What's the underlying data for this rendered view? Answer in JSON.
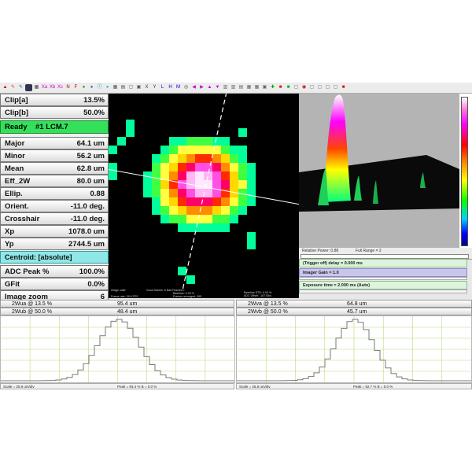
{
  "toolbar": {
    "color_letters": [
      "Xa",
      "Xb",
      "Xc"
    ],
    "letters": [
      "N",
      "F"
    ],
    "axis_letters": [
      "X",
      "Y",
      "L",
      "H",
      "M"
    ]
  },
  "measurements": [
    {
      "label": "Clip[a]",
      "value": "13.5%"
    },
    {
      "label": "Clip[b]",
      "value": "50.0%"
    },
    {
      "label": "Ready",
      "value": "#1 LCM.7"
    },
    {
      "label": "Major",
      "value": "64.1 um"
    },
    {
      "label": "Minor",
      "value": "56.2 um"
    },
    {
      "label": "Mean",
      "value": "62.8 um"
    },
    {
      "label": "Eff_2W",
      "value": "80.0 um"
    },
    {
      "label": "Ellip.",
      "value": "0.88"
    },
    {
      "label": "Orient.",
      "value": "-11.0 deg."
    },
    {
      "label": "Crosshair",
      "value": "-11.0 deg."
    },
    {
      "label": "Xp",
      "value": "1078.0 um"
    },
    {
      "label": "Yp",
      "value": "2744.5 um"
    },
    {
      "label": "Centroid: [absolute]",
      "value": ""
    },
    {
      "label": "ADC Peak %",
      "value": "100.0%"
    },
    {
      "label": "GFit",
      "value": "0.0%"
    },
    {
      "label": "Image zoom",
      "value": "6"
    }
  ],
  "beam_footer": {
    "image_valid": "Image valid",
    "good_frames": "Good frames: 6  Bad Frames:0",
    "baseline": "Baseline: 0.25 %",
    "frame_rate": "Frame rate: 26.8 FPS",
    "frames_averaged": "Frames averaged: 365",
    "baseline_std": "Baseline STD: 0.04 %",
    "adc_offset": "ADC Offset: -167.0/ks"
  },
  "power": {
    "relative_power": "Relative Power: 0.88",
    "full_range": "Full Range = 2"
  },
  "controls": {
    "trigger": "(Trigger off) delay = 0.000 ms",
    "gain": "Imager Gain = 1.0",
    "exposure": "Exposure time = 2.000 ms (Auto)"
  },
  "profiles": {
    "x": {
      "row1_label": "2Wua @ 13.5 %",
      "row1_value": "95.4 um",
      "row2_label": "2Wub @ 50.0 %",
      "row2_value": "48.4 um",
      "scale": "Scale = 25.8 um/div",
      "peak": "Peak = 93.4 %  B = 0.0 %"
    },
    "y": {
      "row1_label": "2Wva @ 13.5 %",
      "row1_value": "64.8 um",
      "row2_label": "2Wvb @ 50.0 %",
      "row2_value": "45.7 um",
      "scale": "Scale = 25.8 um/div",
      "peak": "Peak = 92.7 %  B = 0.0 %"
    }
  },
  "colors": {
    "ready": "#34e05a",
    "centroid": "#8fe8e8",
    "grid": "#b9dc7a",
    "trace": "#7a7a7a"
  }
}
